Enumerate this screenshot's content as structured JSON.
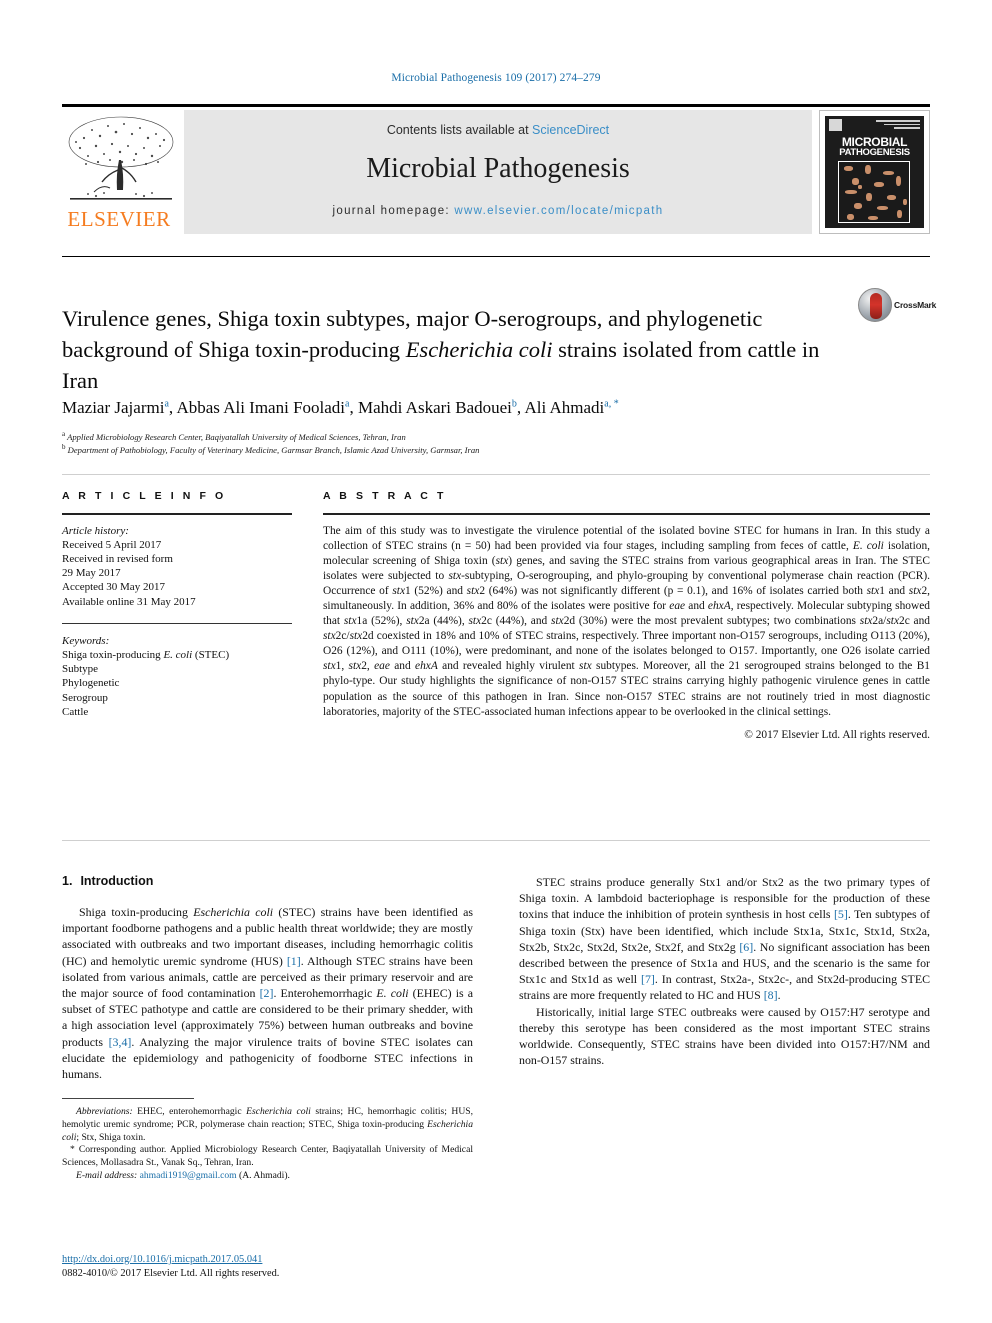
{
  "running_head": "Microbial Pathogenesis 109 (2017) 274–279",
  "masthead": {
    "contents_prefix": "Contents lists available at ",
    "contents_link": "ScienceDirect",
    "journal_title": "Microbial Pathogenesis",
    "homepage_prefix": "journal homepage: ",
    "homepage_url": "www.elsevier.com/locate/micpath",
    "publisher": "ELSEVIER",
    "cover": {
      "line1": "MICROBIAL",
      "line2": "PATHOGENESIS"
    }
  },
  "crossmark": {
    "label": "CrossMark"
  },
  "article": {
    "title_part1": "Virulence genes, Shiga toxin subtypes, major O-serogroups, and phylogenetic background of Shiga toxin-producing ",
    "title_italic": "Escherichia coli",
    "title_part2": " strains isolated from cattle in Iran",
    "authors": [
      {
        "name": "Maziar Jajarmi",
        "sup": "a",
        "sep": ", "
      },
      {
        "name": "Abbas Ali Imani Fooladi",
        "sup": "a",
        "sep": ", "
      },
      {
        "name": "Mahdi Askari Badouei",
        "sup": "b",
        "sep": ", "
      },
      {
        "name": "Ali Ahmadi",
        "sup": "a",
        "sup2": ", *",
        "sep": ""
      }
    ],
    "affiliations": [
      {
        "mark": "a",
        "text": "Applied Microbiology Research Center, Baqiyatallah University of Medical Sciences, Tehran, Iran"
      },
      {
        "mark": "b",
        "text": "Department of Pathobiology, Faculty of Veterinary Medicine, Garmsar Branch, Islamic Azad University, Garmsar, Iran"
      }
    ]
  },
  "article_info": {
    "heading": "A R T I C L E   I N F O",
    "history_label": "Article history:",
    "history": [
      "Received 5 April 2017",
      "Received in revised form",
      "29 May 2017",
      "Accepted 30 May 2017",
      "Available online 31 May 2017"
    ],
    "keywords_label": "Keywords:",
    "keywords": [
      "Shiga toxin-producing E. coli (STEC)",
      "Subtype",
      "Phylogenetic",
      "Serogroup",
      "Cattle"
    ]
  },
  "abstract": {
    "heading": "A B S T R A C T",
    "text": "The aim of this study was to investigate the virulence potential of the isolated bovine STEC for humans in Iran. In this study a collection of STEC strains (n = 50) had been provided via four stages, including sampling from feces of cattle, E. coli isolation, molecular screening of Shiga toxin (stx) genes, and saving the STEC strains from various geographical areas in Iran. The STEC isolates were subjected to stx-subtyping, O-serogrouping, and phylo-grouping by conventional polymerase chain reaction (PCR). Occurrence of stx1 (52%) and stx2 (64%) was not significantly different (p = 0.1), and 16% of isolates carried both stx1 and stx2, simultaneously. In addition, 36% and 80% of the isolates were positive for eae and ehxA, respectively. Molecular subtyping showed that stx1a (52%), stx2a (44%), stx2c (44%), and stx2d (30%) were the most prevalent subtypes; two combinations stx2a/stx2c and stx2c/stx2d coexisted in 18% and 10% of STEC strains, respectively. Three important non-O157 serogroups, including O113 (20%), O26 (12%), and O111 (10%), were predominant, and none of the isolates belonged to O157. Importantly, one O26 isolate carried stx1, stx2, eae and ehxA and revealed highly virulent stx subtypes. Moreover, all the 21 serogrouped strains belonged to the B1 phylo-type. Our study highlights the significance of non-O157 STEC strains carrying highly pathogenic virulence genes in cattle population as the source of this pathogen in Iran. Since non-O157 STEC strains are not routinely tried in most diagnostic laboratories, majority of the STEC-associated human infections appear to be overlooked in the clinical settings.",
    "copyright": "© 2017 Elsevier Ltd. All rights reserved."
  },
  "introduction": {
    "number": "1.",
    "heading": "Introduction",
    "paragraph1": "Shiga toxin-producing Escherichia coli (STEC) strains have been identified as important foodborne pathogens and a public health threat worldwide; they are mostly associated with outbreaks and two important diseases, including hemorrhagic colitis (HC) and hemolytic uremic syndrome (HUS) [1]. Although STEC strains have been isolated from various animals, cattle are perceived as their primary reservoir and are the major source of food contamination [2]. Enterohemorrhagic E. coli (EHEC) is a subset of STEC pathotype and cattle are considered to be their primary shedder, with a high association level (approximately 75%) between human outbreaks and bovine products [3,4]. Analyzing the major virulence traits of bovine STEC isolates can elucidate the epidemiology and pathogenicity of foodborne STEC infections in humans.",
    "paragraph2": "STEC strains produce generally Stx1 and/or Stx2 as the two primary types of Shiga toxin. A lambdoid bacteriophage is responsible for the production of these toxins that induce the inhibition of protein synthesis in host cells [5]. Ten subtypes of Shiga toxin (Stx) have been identified, which include Stx1a, Stx1c, Stx1d, Stx2a, Stx2b, Stx2c, Stx2d, Stx2e, Stx2f, and Stx2g [6]. No significant association has been described between the presence of Stx1a and HUS, and the scenario is the same for Stx1c and Stx1d as well [7]. In contrast, Stx2a-, Stx2c-, and Stx2d-producing STEC strains are more frequently related to HC and HUS [8].",
    "paragraph3": "Historically, initial large STEC outbreaks were caused by O157:H7 serotype and thereby this serotype has been considered as the most important STEC strains worldwide. Consequently, STEC strains have been divided into O157:H7/NM and non-O157 strains."
  },
  "footnotes": {
    "abbreviations_label": "Abbreviations:",
    "abbreviations": "EHEC, enterohemorrhagic Escherichia coli strains; HC, hemorrhagic colitis; HUS, hemolytic uremic syndrome; PCR, polymerase chain reaction; STEC, Shiga toxin-producing Escherichia coli; Stx, Shiga toxin.",
    "corresponding": "* Corresponding author. Applied Microbiology Research Center, Baqiyatallah University of Medical Sciences, Mollasadra St., Vanak Sq., Tehran, Iran.",
    "email_label": "E-mail address:",
    "email": "ahmadi1919@gmail.com",
    "email_suffix": " (A. Ahmadi)."
  },
  "doi_block": {
    "doi": "http://dx.doi.org/10.1016/j.micpath.2017.05.041",
    "issn_line": "0882-4010/© 2017 Elsevier Ltd. All rights reserved."
  },
  "colors": {
    "link": "#1a6ea8",
    "sciencedirect": "#3a8ec7",
    "elsevier_orange": "#f57c20",
    "masthead_bg": "#e6e6e6"
  }
}
